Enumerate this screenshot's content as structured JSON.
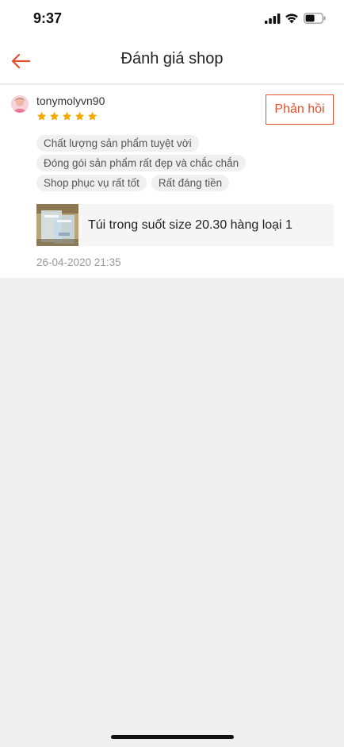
{
  "status_bar": {
    "time": "9:37"
  },
  "header": {
    "title": "Đánh giá shop"
  },
  "review": {
    "username": "tonymolyvn90",
    "rating": 5,
    "reply_label": "Phản hồi",
    "tags": [
      "Chất lượng sản phẩm tuyệt vời",
      "Đóng gói sản phẩm rất đẹp và chắc chắn",
      "Shop phục vụ rất tốt",
      "Rất đáng tiền"
    ],
    "product_name": "Túi trong suốt size 20.30 hàng loại 1",
    "date": "26-04-2020 21:35"
  },
  "colors": {
    "accent": "#e5502f",
    "star": "#f6a700",
    "background": "#efefef"
  }
}
